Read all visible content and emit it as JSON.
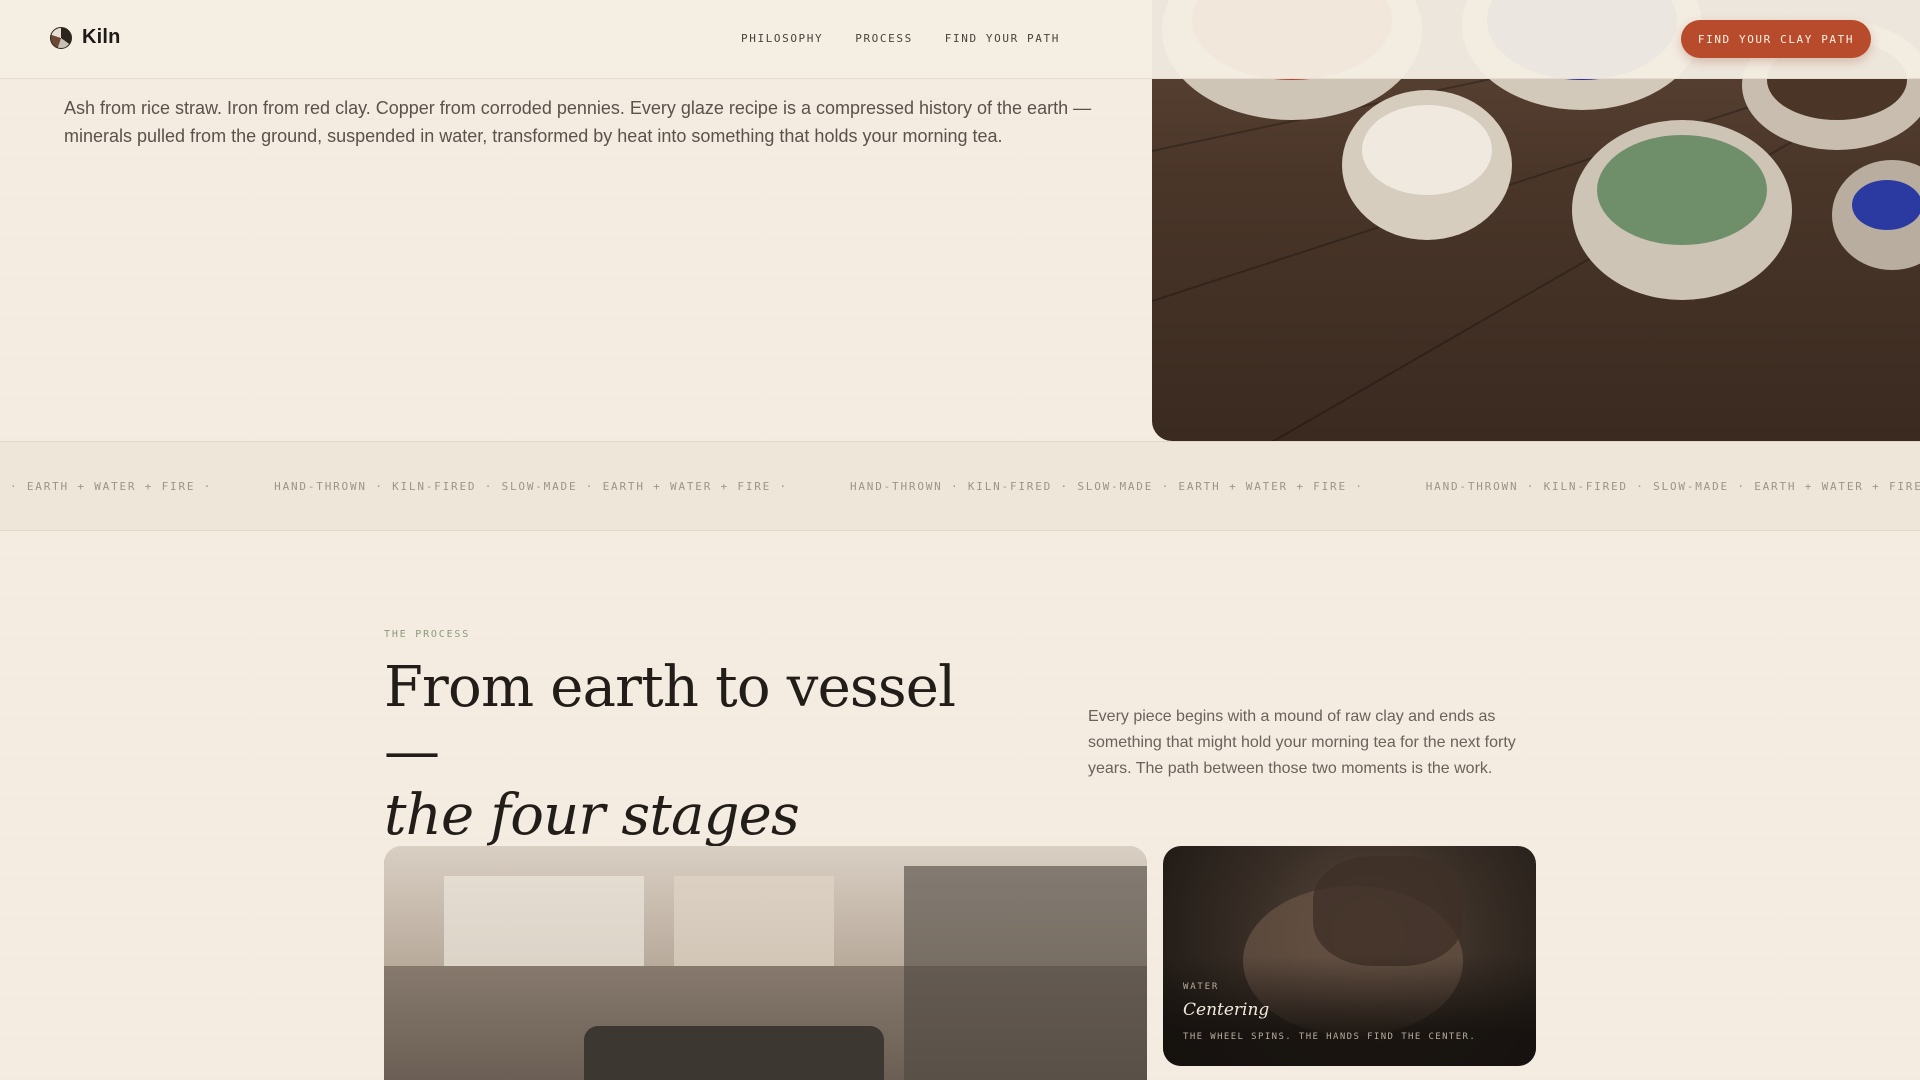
{
  "nav": {
    "brand": "Kiln",
    "links": [
      "PHILOSOPHY",
      "PROCESS",
      "FIND YOUR PATH"
    ],
    "cta": "FIND YOUR CLAY PATH"
  },
  "hero": {
    "intro": "Ash from rice straw. Iron from red clay. Copper from corroded pennies. Every glaze recipe is a compressed history of the earth — minerals pulled from the ground, suspended in water, transformed by heat into something that holds your morning tea.",
    "image": "glaze-pigment-bowls"
  },
  "ticker": {
    "items": [
      "· EARTH + WATER + FIRE ·",
      "HAND-THROWN · KILN-FIRED · SLOW-MADE · EARTH + WATER + FIRE ·",
      "HAND-THROWN · KILN-FIRED · SLOW-MADE · EARTH + WATER + FIRE ·",
      "HAND-THROWN · KILN-FIRED · SLOW-MADE · EARTH + WATER + FIRE ·"
    ]
  },
  "process": {
    "eyebrow": "THE PROCESS",
    "heading_line1": "From earth to vessel —",
    "heading_line2": "the four stages",
    "description": "Every piece begins with a mound of raw clay and ends as something that might hold your morning tea for the next forty years. The path between those two moments is the work.",
    "cards": [
      {
        "image": "studio-clay-block"
      },
      {
        "image": "hands-centering-clay",
        "tag": "WATER",
        "title": "Centering",
        "caption": "THE WHEEL SPINS. THE HANDS FIND THE CENTER."
      }
    ]
  },
  "colors": {
    "background": "#f4ece1",
    "accent": "#b84b2b",
    "eyebrow": "#8a9a7c"
  }
}
